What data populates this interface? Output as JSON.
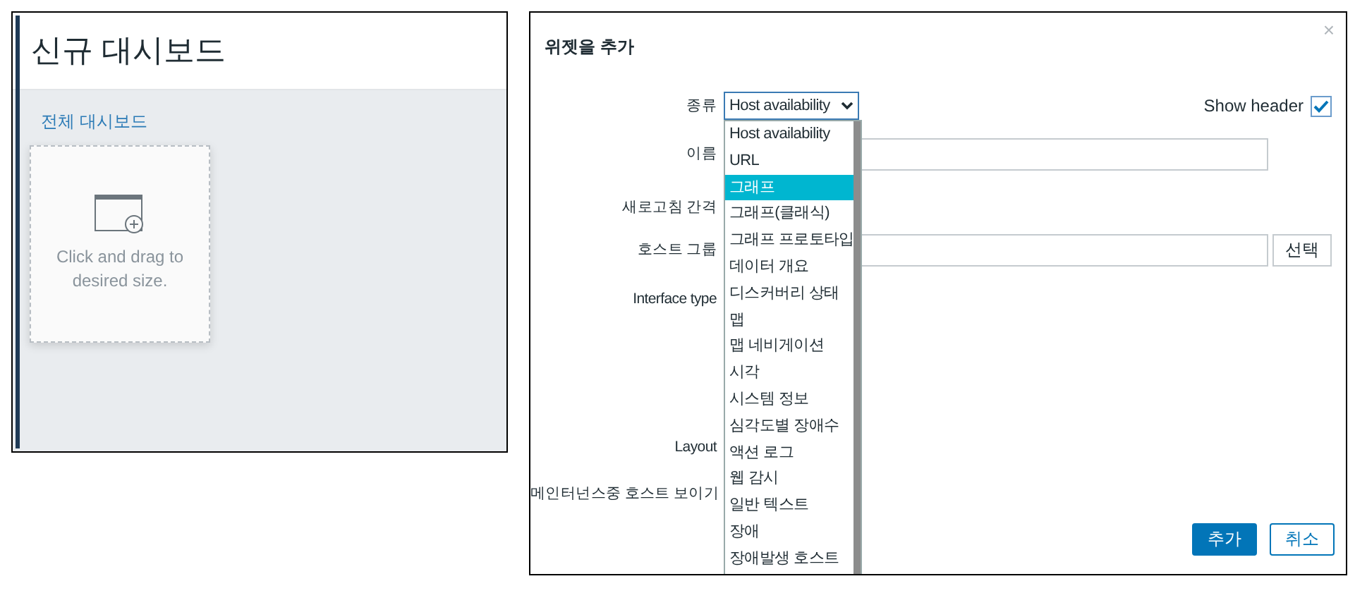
{
  "dashboard": {
    "title": "신규 대시보드",
    "breadcrumb": "전체 대시보드",
    "placeholder": {
      "hint": "Click and drag to desired size."
    }
  },
  "dialog": {
    "title": "위젯을 추가",
    "close": "×",
    "fields": [
      {
        "label": "종류",
        "kind": "select",
        "value": "Host availability"
      },
      {
        "label": "이름",
        "kind": "input"
      },
      {
        "label": "새로고침 간격",
        "kind": "none"
      },
      {
        "label": "호스트 그룹",
        "kind": "picker",
        "button": "선택"
      },
      {
        "label": "Interface type",
        "kind": "none"
      },
      {
        "label": "Layout",
        "kind": "none"
      },
      {
        "label": "메인터넌스중 호스트 보이기",
        "kind": "none"
      }
    ],
    "show_header": {
      "label": "Show header",
      "checked": true
    },
    "dropdown": [
      {
        "label": "Host availability",
        "selected": false
      },
      {
        "label": "URL",
        "selected": false
      },
      {
        "label": "그래프",
        "selected": true
      },
      {
        "label": "그래프(클래식)",
        "selected": false
      },
      {
        "label": "그래프 프로토타입",
        "selected": false
      },
      {
        "label": "데이터 개요",
        "selected": false
      },
      {
        "label": "디스커버리 상태",
        "selected": false
      },
      {
        "label": "맵",
        "selected": false
      },
      {
        "label": "맵 네비게이션",
        "selected": false
      },
      {
        "label": "시각",
        "selected": false
      },
      {
        "label": "시스템 정보",
        "selected": false
      },
      {
        "label": "심각도별 장애수",
        "selected": false
      },
      {
        "label": "액션 로그",
        "selected": false
      },
      {
        "label": "웹 감시",
        "selected": false
      },
      {
        "label": "일반 텍스트",
        "selected": false
      },
      {
        "label": "장애",
        "selected": false
      },
      {
        "label": "장애발생 호스트",
        "selected": false
      }
    ],
    "buttons": [
      {
        "label": "추가",
        "kind": "primary"
      },
      {
        "label": "취소",
        "kind": "secondary"
      }
    ]
  }
}
